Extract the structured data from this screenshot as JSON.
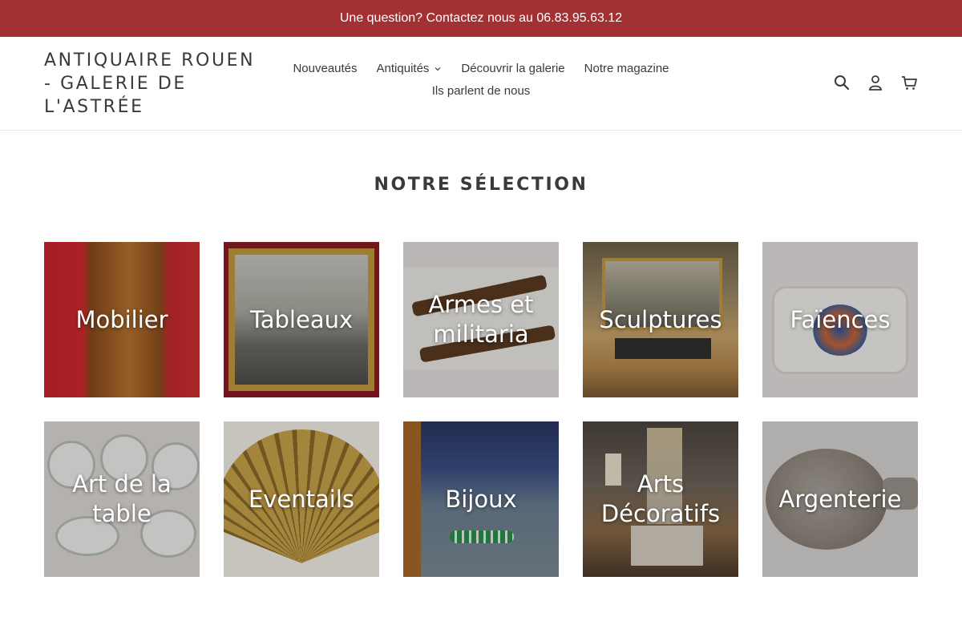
{
  "announcement": {
    "text": "Une question? Contactez nous au 06.83.95.63.12"
  },
  "header": {
    "logo": "ANTIQUAIRE ROUEN - GALERIE DE L'ASTRÉE",
    "nav": {
      "row1": [
        {
          "label": "Nouveautés"
        },
        {
          "label": "Antiquités",
          "dropdown": true
        },
        {
          "label": "Découvrir la galerie"
        },
        {
          "label": "Notre magazine"
        }
      ],
      "row2": [
        {
          "label": "Ils parlent de nous"
        }
      ]
    },
    "icons": [
      "search-icon",
      "account-icon",
      "cart-icon"
    ]
  },
  "section": {
    "title": "NOTRE SÉLECTION"
  },
  "categories": [
    {
      "label": "Mobilier"
    },
    {
      "label": "Tableaux"
    },
    {
      "label": "Armes et militaria"
    },
    {
      "label": "Sculptures"
    },
    {
      "label": "Faïences"
    },
    {
      "label": "Art de la table"
    },
    {
      "label": "Eventails"
    },
    {
      "label": "Bijoux"
    },
    {
      "label": "Arts Décoratifs"
    },
    {
      "label": "Argenterie"
    }
  ],
  "colors": {
    "announcement_bg": "#a33032",
    "text": "#3a3a3a"
  }
}
